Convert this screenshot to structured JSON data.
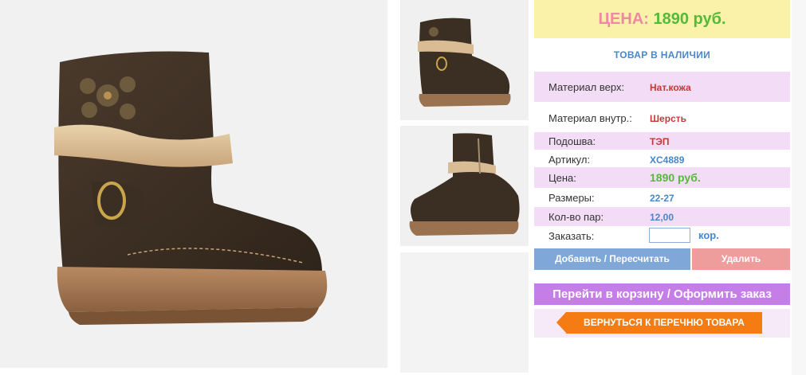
{
  "price_box": {
    "label": "ЦЕНА:",
    "value": "1890 руб."
  },
  "stock_status": "ТОВАР В НАЛИЧИИ",
  "specs": [
    {
      "key": "Материал верх:",
      "value": "Нат.кожа"
    },
    {
      "key": "Материал внутр.:",
      "value": "Шерсть"
    },
    {
      "key": "Подошва:",
      "value": "ТЭП"
    },
    {
      "key": "Артикул:",
      "value": "XC4889"
    },
    {
      "key": "Цена:",
      "value": "1890 руб."
    },
    {
      "key": "Размеры:",
      "value": "22-27"
    },
    {
      "key": "Кол-во пар:",
      "value": "12,00"
    },
    {
      "key": "Заказать:",
      "value": ""
    }
  ],
  "order": {
    "unit": "кор.",
    "quantity": ""
  },
  "buttons": {
    "add": "Добавить / Пересчитать",
    "delete": "Удалить",
    "cart": "Перейти в корзину / Оформить заказ",
    "back": "ВЕРНУТЬСЯ К ПЕРЕЧНЮ ТОВАРА"
  },
  "colors": {
    "price_bg": "#f9f2a8",
    "price_label": "#ec8aa0",
    "price_value": "#55b93a",
    "accent_blue": "#4a86c8",
    "value_red": "#c13a3a",
    "row_pink": "#f3dcf5",
    "btn_add": "#7fa7d8",
    "btn_delete": "#ee9c9c",
    "btn_cart": "#c57ee8",
    "btn_back": "#f47c12"
  }
}
